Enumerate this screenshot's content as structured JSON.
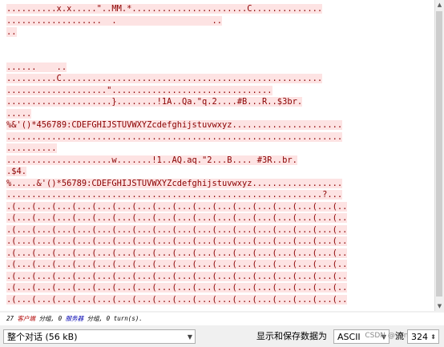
{
  "stream_lines": [
    "..........x.x.....\"..MM.*.......................C..............",
    "...................  .                   ..",
    "..",
    "",
    "",
    "......    ..",
    "..........C....................................................",
    "....................\"................................",
    ".....................}........!1A..Qa.\"q.2....#B...R..$3br.",
    ".....",
    "%&'()*456789:CDEFGHIJSTUVWXYZcdefghijstuvwxyz......................",
    "...................................................................",
    "..........",
    ".....................w.......!1..AQ.aq.\"2...B.... #3R..br.",
    ".$4.",
    "%.....&'()*56789:CDEFGHIJSTUVWXYZcdefghijstuvwxyz..................",
    "...............................................................?...",
    ".(...(...(...(...(...(...(...(...(...(...(...(...(...(...(...(...(..",
    ".(...(...(...(...(...(...(...(...(...(...(...(...(...(...(...(...(..",
    ".(...(...(...(...(...(...(...(...(...(...(...(...(...(...(...(...(..",
    ".(...(...(...(...(...(...(...(...(...(...(...(...(...(...(...(...(..",
    ".(...(...(...(...(...(...(...(...(...(...(...(...(...(...(...(...(..",
    ".(...(...(...(...(...(...(...(...(...(...(...(...(...(...(...(...(..",
    ".(...(...(...(...(...(...(...(...(...(...(...(...(...(...(...(...(..",
    ".(...(...(...(...(...(...(...(...(...(...(...(...(...(...(...(...(..",
    ".(...(...(...(...(...(...(...(...(...(...(...(...(...(...(...(...(.."
  ],
  "summary": {
    "client_count": "27",
    "client_label": "客户端",
    "client_unit": "分组,",
    "server_count": "0",
    "server_label": "服务器",
    "server_unit": "分组,",
    "turns": "0 turn(s)."
  },
  "bottombar": {
    "conversation_select": "整个对话 (56 kB)",
    "show_save_label": "显示和保存数据为",
    "format_select": "ASCII",
    "stream_label": "流",
    "stream_number": "324",
    "watermark": "CSDN @yan..."
  },
  "colors": {
    "client_text": "#8b0000",
    "client_bg": "#fde3e3"
  }
}
